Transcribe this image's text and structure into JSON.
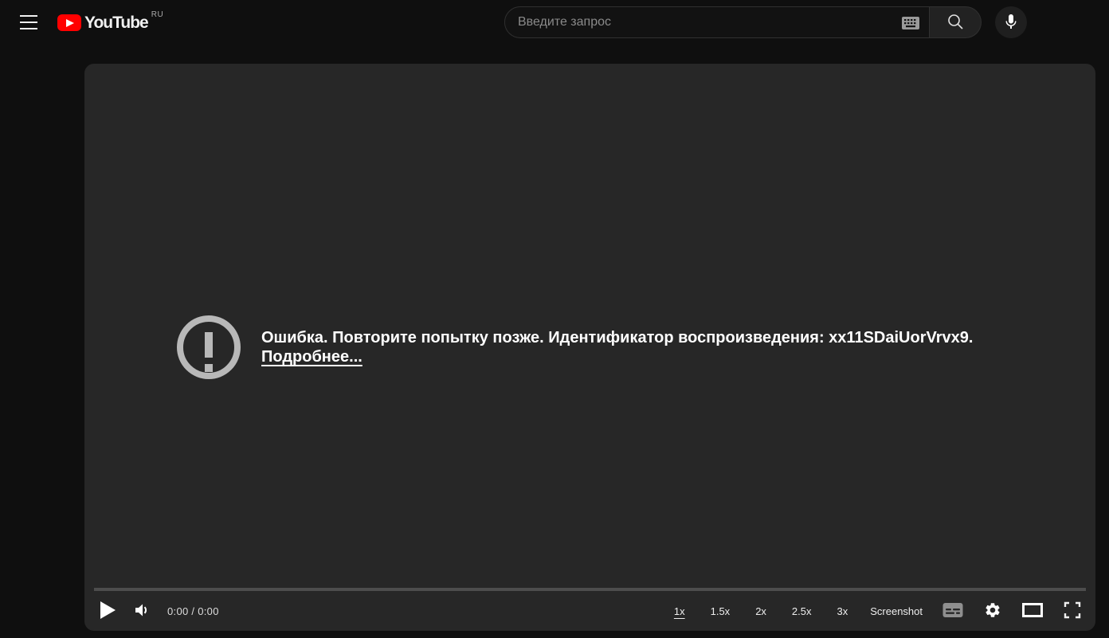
{
  "colors": {
    "page_bg": "#0f0f0f",
    "player_bg": "#272727",
    "brand_red": "#ff0000",
    "search_border": "#303030",
    "progress_bar_gray": "#4d4d4d",
    "error_icon_gray": "#b8b8b8"
  },
  "header": {
    "logo": {
      "wordmark": "YouTube",
      "country_code": "RU"
    },
    "search": {
      "placeholder": "Введите запрос",
      "value": ""
    },
    "icons": {
      "menu": "hamburger-lines",
      "keyboard": "virtual-keyboard-glyph",
      "search": "magnifier-glyph",
      "mic": "microphone-glyph"
    }
  },
  "player": {
    "error": {
      "message": "Ошибка. Повторите попытку позже. Идентификатор воспроизведения: xx11SDaiUorVrvx9.",
      "details_label": "Подробнее..."
    },
    "controls": {
      "time_display": "0:00 / 0:00",
      "speeds": [
        {
          "label": "1x",
          "active": true
        },
        {
          "label": "1.5x",
          "active": false
        },
        {
          "label": "2x",
          "active": false
        },
        {
          "label": "2.5x",
          "active": false
        },
        {
          "label": "3x",
          "active": false
        }
      ],
      "screenshot_label": "Screenshot",
      "icons": {
        "play": "play-triangle",
        "volume": "speaker-with-wave",
        "subtitles": "cc-rectangle",
        "settings": "gear",
        "theater": "wide-rectangle",
        "fullscreen": "corner-brackets"
      }
    }
  }
}
